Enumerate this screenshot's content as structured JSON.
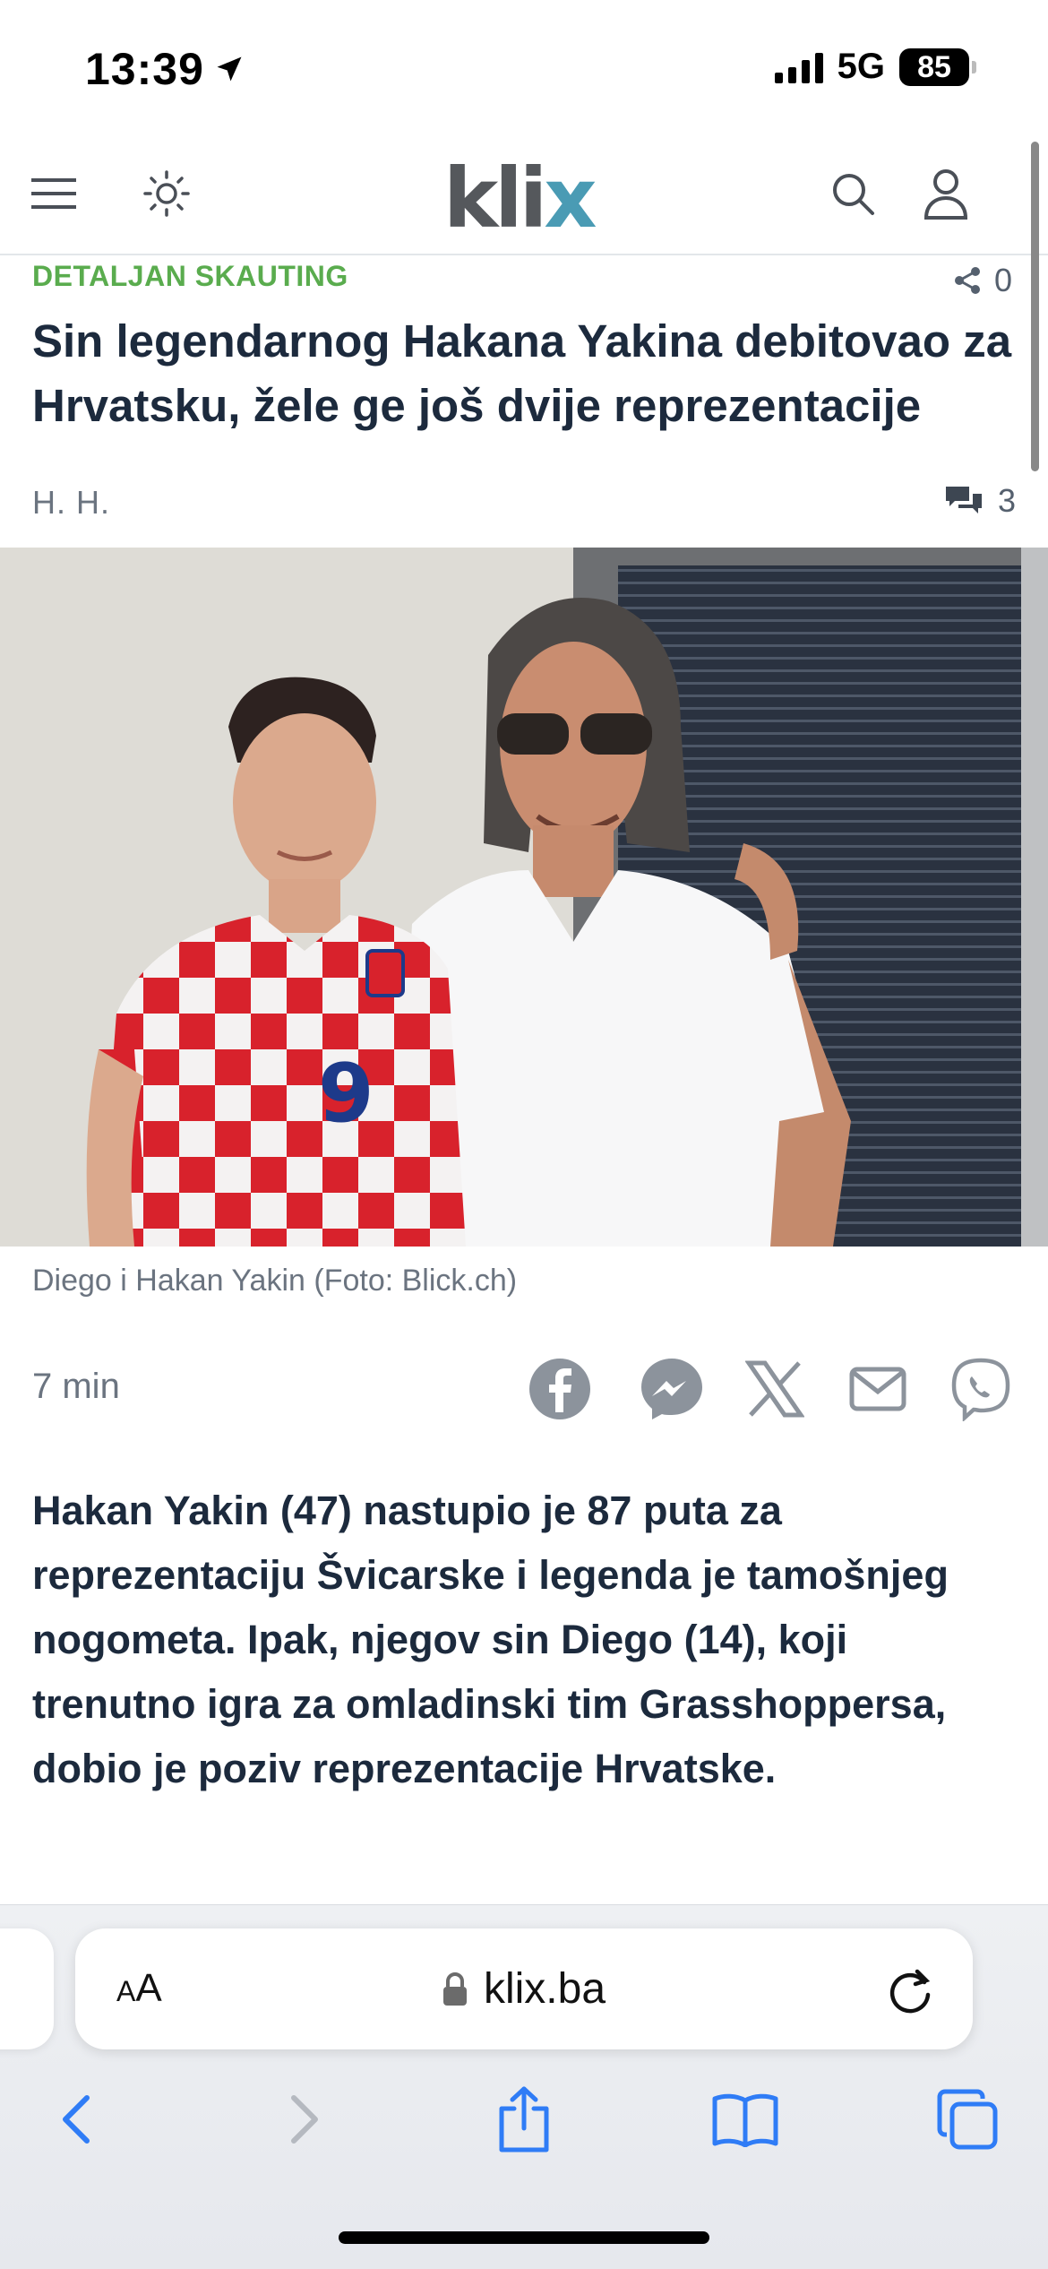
{
  "status_bar": {
    "time": "13:39",
    "network": "5G",
    "battery": "85"
  },
  "header": {
    "logo_text": "kli",
    "logo_x": "x"
  },
  "article": {
    "kicker": "DETALJAN SKAUTING",
    "share_count": "0",
    "headline": "Sin legendarnog Hakana Yakina debitovao za Hrvatsku, žele ge još dvije reprezentacije",
    "author": "H. H.",
    "comment_count": "3",
    "photo_caption": "Diego i Hakan Yakin (Foto: Blick.ch)",
    "read_time": "7 min",
    "lead": "Hakan Yakin (47) nastupio je 87 puta za reprezentaciju Švicarske i legenda je tamošnjeg nogometa. Ipak, njegov sin Diego (14), koji trenutno igra za omladinski tim Grasshoppersa, dobio je poziv reprezentacije Hrvatske."
  },
  "share_icons": [
    "facebook-icon",
    "messenger-icon",
    "x-icon",
    "email-icon",
    "viber-icon"
  ],
  "browser": {
    "aa_small": "A",
    "aa_large": "A",
    "url": "klix.ba"
  },
  "colors": {
    "accent_green": "#5aac4e",
    "logo_gray": "#55585c",
    "logo_blue": "#4a9bb4",
    "ios_blue": "#2f7cf6"
  }
}
